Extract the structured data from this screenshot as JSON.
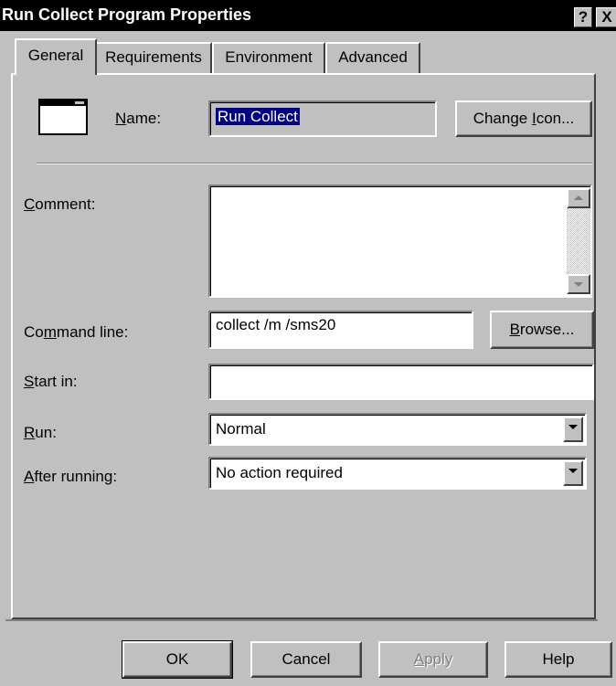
{
  "window": {
    "title": "Run Collect Program Properties",
    "help_glyph": "?",
    "close_glyph": "X"
  },
  "tabs": [
    {
      "label": "General",
      "active": true
    },
    {
      "label": "Requirements",
      "active": false
    },
    {
      "label": "Environment",
      "active": false
    },
    {
      "label": "Advanced",
      "active": false
    }
  ],
  "general": {
    "icon": "program-window-icon",
    "name_label_pre": "",
    "name_label_u": "N",
    "name_label_post": "ame:",
    "name_value": "Run Collect",
    "change_icon_pre": "Change ",
    "change_icon_u": "I",
    "change_icon_post": "con...",
    "comment_label_u": "C",
    "comment_label_post": "omment:",
    "comment_value": "",
    "command_line_label_pre": "Co",
    "command_line_label_u": "m",
    "command_line_label_post": "mand line:",
    "command_line_value": "collect /m /sms20",
    "browse_u": "B",
    "browse_post": "rowse...",
    "start_in_label_u": "S",
    "start_in_label_post": "tart in:",
    "start_in_value": "",
    "run_label_u": "R",
    "run_label_post": "un:",
    "run_value": "Normal",
    "after_running_label_u": "A",
    "after_running_label_post": "fter running:",
    "after_running_value": "No action required"
  },
  "footer": {
    "ok_label": "OK",
    "cancel_label": "Cancel",
    "apply_u": "A",
    "apply_post": "pply",
    "help_label": "Help"
  },
  "colors": {
    "dialog_bg": "#c0c0c0",
    "titlebar_bg": "#000000",
    "selection": "#000080"
  }
}
